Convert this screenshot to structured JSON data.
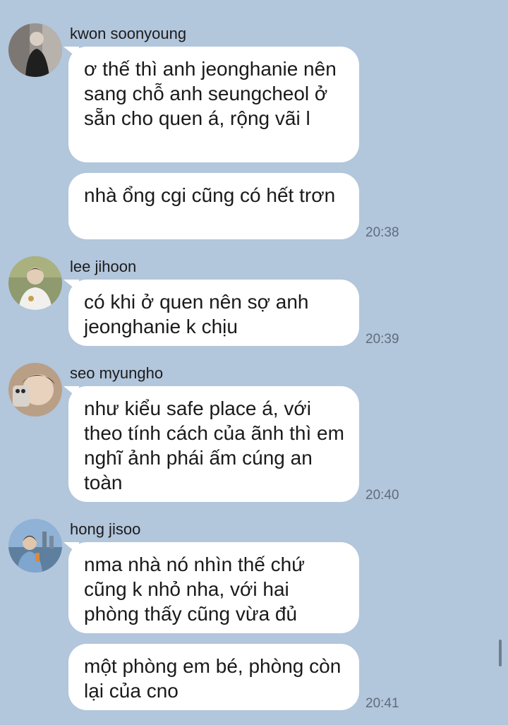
{
  "messages": [
    {
      "sender": "kwon soonyoung",
      "bubbles": [
        "ơ thế thì anh jeonghanie nên sang chỗ anh seungcheol ở sẵn cho quen á, rộng vãi l",
        "nhà ổng cgi cũng có hết trơn"
      ],
      "time": "20:38"
    },
    {
      "sender": "lee jihoon",
      "bubbles": [
        "có khi ở quen nên sợ anh jeonghanie k chịu"
      ],
      "time": "20:39"
    },
    {
      "sender": "seo myungho",
      "bubbles": [
        "như kiểu safe place á, với theo tính cách của ãnh thì em nghĩ ảnh phái ấm cúng an toàn"
      ],
      "time": "20:40"
    },
    {
      "sender": "hong jisoo",
      "bubbles": [
        "nma nhà nó nhìn thế chứ cũng k nhỏ nha, với hai phòng thấy cũng vừa đủ",
        "một phòng em bé, phòng còn lại của cno"
      ],
      "time": "20:41"
    }
  ]
}
